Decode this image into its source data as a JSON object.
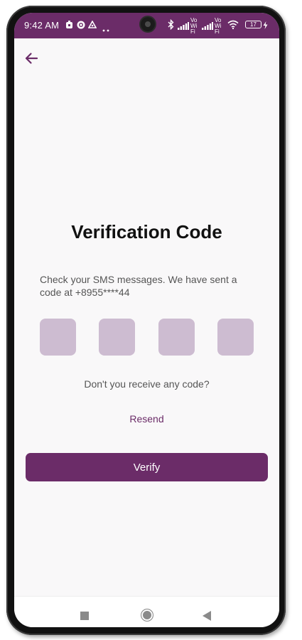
{
  "status_bar": {
    "time": "9:42 AM",
    "battery": "17",
    "network_label": "Vo WiFi",
    "icons": [
      "notification-icon",
      "whatsapp-icon",
      "drive-icon",
      "more-dots-icon",
      "camera-cutout",
      "bluetooth-icon",
      "signal-icon",
      "vowifi-icon",
      "signal-icon",
      "vowifi-icon",
      "wifi-icon",
      "battery-icon",
      "charging-icon"
    ]
  },
  "header": {
    "back_icon": "arrow-left-icon"
  },
  "main": {
    "title": "Verification Code",
    "description": "Check your SMS messages. We have sent a code at +8955****44",
    "otp_digits": [
      "",
      "",
      "",
      ""
    ],
    "hint": "Don't you receive any code?",
    "resend_label": "Resend",
    "verify_label": "Verify"
  },
  "nav_bar": {
    "icons": [
      "recent-apps-icon",
      "home-icon",
      "back-icon"
    ]
  },
  "colors": {
    "accent": "#6b2c68",
    "otp_box": "#cdbcd1",
    "background": "#f9f8f9"
  }
}
